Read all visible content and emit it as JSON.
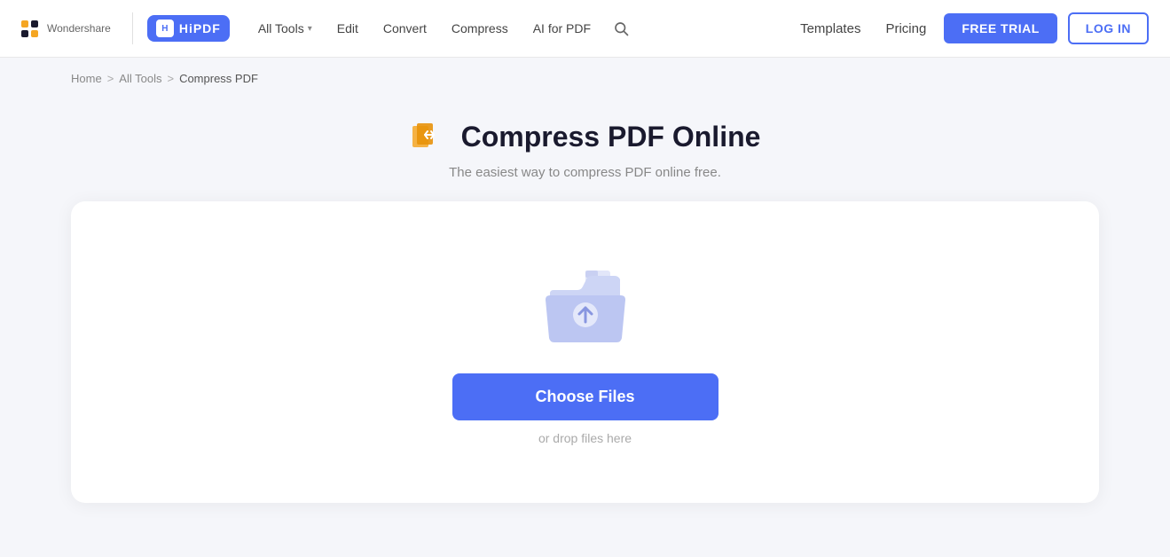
{
  "header": {
    "logo_alt": "Wondershare",
    "hipdf_label": "HiPDF",
    "nav": {
      "all_tools_label": "All Tools",
      "edit_label": "Edit",
      "convert_label": "Convert",
      "compress_label": "Compress",
      "ai_label": "AI for PDF"
    },
    "right": {
      "templates_label": "Templates",
      "pricing_label": "Pricing",
      "free_trial_label": "FREE TRIAL",
      "login_label": "LOG IN"
    }
  },
  "breadcrumb": {
    "home": "Home",
    "all_tools": "All Tools",
    "current": "Compress PDF",
    "sep1": ">",
    "sep2": ">"
  },
  "hero": {
    "title": "Compress PDF Online",
    "subtitle": "The easiest way to compress PDF online free."
  },
  "upload": {
    "choose_files_label": "Choose Files",
    "drop_hint": "or drop files here"
  },
  "colors": {
    "accent": "#4c6ef5",
    "orange": "#f5a623"
  }
}
